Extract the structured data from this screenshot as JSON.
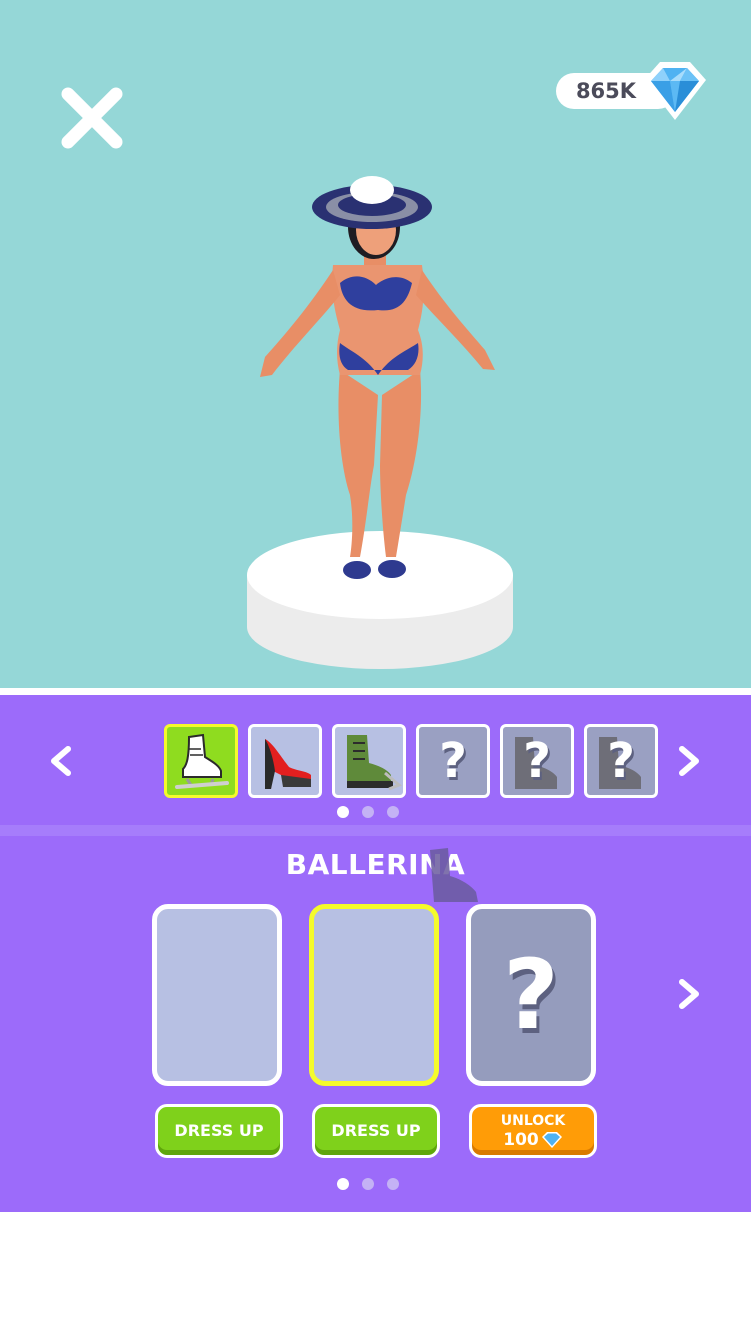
{
  "header": {
    "close_icon": "close-x-icon",
    "gems": {
      "count": "865K",
      "icon": "diamond-icon"
    }
  },
  "shoe_bar": {
    "prev_icon": "chevron-left-icon",
    "next_icon": "chevron-right-icon",
    "items": [
      {
        "icon": "ice-skate-icon",
        "state": "selected"
      },
      {
        "icon": "red-high-heel-icon",
        "state": "unlocked"
      },
      {
        "icon": "green-combat-boot-icon",
        "state": "unlocked"
      },
      {
        "label": "?",
        "state": "locked"
      },
      {
        "label": "?",
        "state": "locked"
      },
      {
        "label": "?",
        "state": "locked"
      }
    ],
    "page": 1,
    "pages": 3
  },
  "outfit_section": {
    "title": "BALLERINA",
    "next_icon": "chevron-right-icon",
    "cards": [
      {
        "state": "unlocked"
      },
      {
        "state": "selected"
      },
      {
        "state": "locked",
        "label": "?"
      }
    ],
    "buttons": [
      {
        "label": "DRESS UP"
      },
      {
        "label": "DRESS UP"
      },
      {
        "label": "UNLOCK",
        "price": "100",
        "icon": "diamond-icon"
      }
    ],
    "page": 1,
    "pages": 3
  },
  "colors": {
    "stage_bg": "#95d7d7",
    "panel_bg": "#9c6bfa",
    "selected_border": "#f5fb2b",
    "green_button": "#7fd11b",
    "orange_button": "#ff9c07"
  }
}
